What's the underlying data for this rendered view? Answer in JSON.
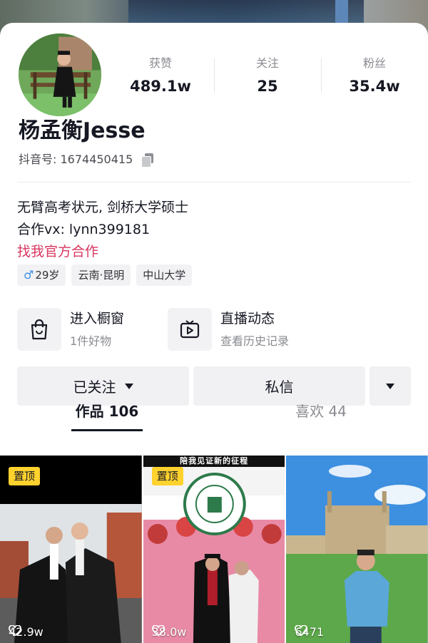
{
  "profile": {
    "name": "杨孟衡Jesse",
    "account_id": "抖音号: 1674450415",
    "bio_line1": "无臂高考状元, 剑桥大学硕士",
    "bio_line2": "合作vx: lynn399181",
    "bio_link": "找我官方合作",
    "tags": {
      "age": "29岁",
      "gender_symbol": "♂",
      "location": "云南·昆明",
      "school": "中山大学"
    }
  },
  "stats": [
    {
      "label": "获赞",
      "value": "489.1w"
    },
    {
      "label": "关注",
      "value": "25"
    },
    {
      "label": "粉丝",
      "value": "35.4w"
    }
  ],
  "features": {
    "shop": {
      "title": "进入橱窗",
      "subtitle": "1件好物",
      "icon": "shopping-bag-icon"
    },
    "live": {
      "title": "直播动态",
      "subtitle": "查看历史记录",
      "icon": "tv-icon"
    }
  },
  "actions": {
    "follow": "已关注",
    "message": "私信"
  },
  "tabs": [
    {
      "label": "作品 106",
      "active": true
    },
    {
      "label": "喜欢 44",
      "active": false
    }
  ],
  "videos": [
    {
      "pinned_label": "置顶",
      "likes": "42.9w"
    },
    {
      "pinned_label": "置顶",
      "likes": "38.0w",
      "banner": "陪我见证新的征程",
      "sign_top": "中山大学",
      "sign_bottom": "SUN YAT-SEN UNIVERSITY"
    },
    {
      "pinned_label": "",
      "likes": "6471"
    }
  ],
  "colors": {
    "accent_link": "#d8365f",
    "pin_badge": "#ffd22e",
    "male_icon": "#3a8ee6"
  }
}
